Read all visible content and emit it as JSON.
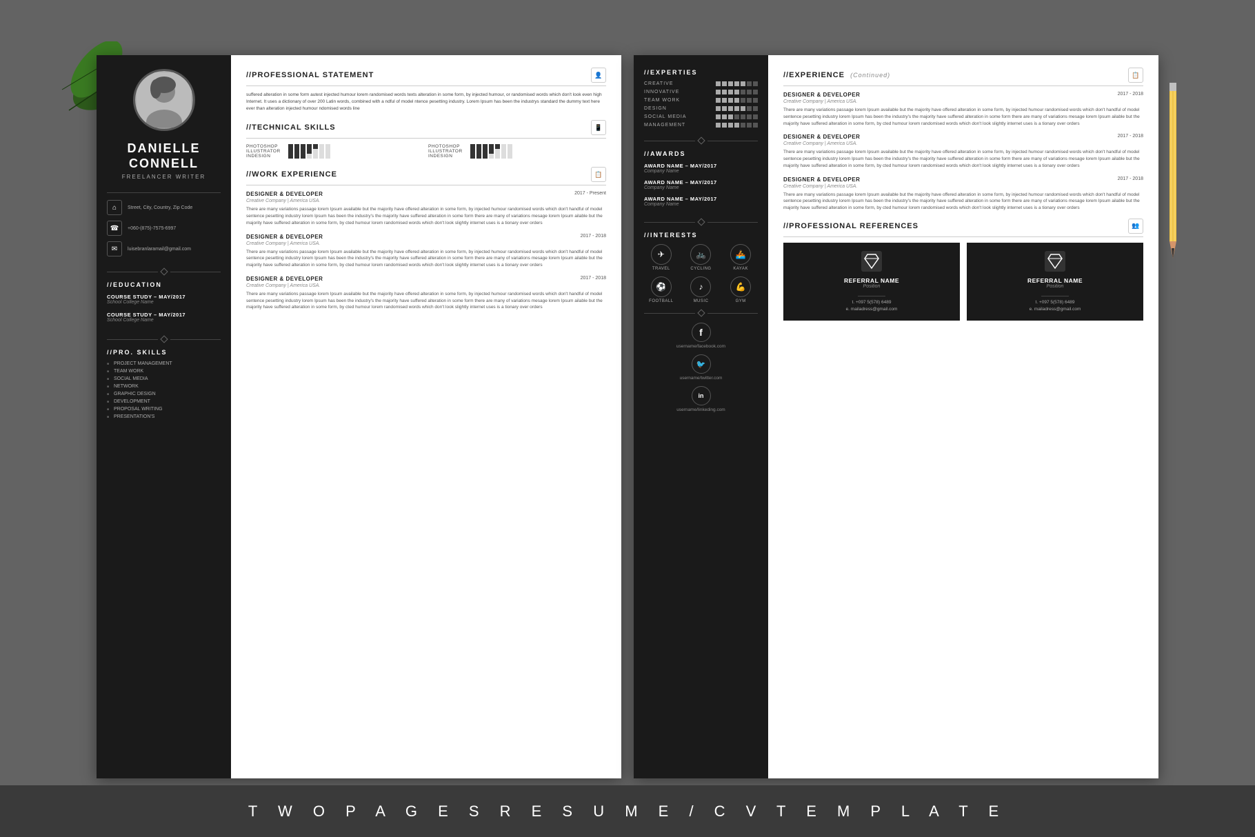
{
  "footer": {
    "text": "T W O   P A G E S   R E S U M E / C V   T E M P L A T E"
  },
  "page1": {
    "sidebar": {
      "name": "DANIELLE\nCONNELL",
      "job_title": "FREELANCER WRITER",
      "address": "Street, City, Country, Zip Code",
      "phone": "+060-(875)-7575-6997",
      "email": "luisebranlaramail@gmail.com",
      "education_title": "//EDUCATION",
      "education": [
        {
          "course": "COURSE STUDY – MAY/2017",
          "school": "School College Name"
        },
        {
          "course": "COURSE STUDY – MAY/2017",
          "school": "School College Name"
        }
      ],
      "pro_skills_title": "//PRO. SKILLS",
      "pro_skills": [
        "PROJECT MANAGEMENT",
        "TEAM WORK",
        "SOCIAL MEDIA",
        "NETWORK",
        "GRAPHIC DESIGN",
        "DEVELOPMENT",
        "PROPOSAL WRITING",
        "PRESENTATION'S"
      ]
    },
    "main": {
      "professional_statement": {
        "title": "//PROFESSIONAL STATEMENT",
        "text": "suffered alteration in some form autest injected humour lorem randomised words texts alteration in some form, by injected humour, or randomised words which don't look even high Internet. It uses a dictionary of over 200 Latin words, combined with a ndful of model ntence pesetting industry. Lorem Ipsum has been the industrys standard the dummy text here ever than alteration injected humour ndomised words line"
      },
      "technical_skills": {
        "title": "//TECHNICAL SKILLS",
        "skills": [
          {
            "name": "PHOTOSHOP",
            "filled": 5,
            "empty": 2
          },
          {
            "name": "ILLUSTRATOR",
            "filled": 4,
            "empty": 3
          },
          {
            "name": "INDESIGN",
            "filled": 3,
            "empty": 4
          }
        ],
        "skills2": [
          {
            "name": "PHOTOSHOP",
            "filled": 5,
            "empty": 2
          },
          {
            "name": "ILLUSTRATOR",
            "filled": 4,
            "empty": 3
          },
          {
            "name": "INDESIGN",
            "filled": 3,
            "empty": 4
          }
        ]
      },
      "work_experience": {
        "title": "//WORK EXPERIENCE",
        "jobs": [
          {
            "title": "DESIGNER & DEVELOPER",
            "company": "Creative Company | America USA.",
            "date": "2017 - Present",
            "description": "There are many variations passage lorem Ipsum available but the majority have offered alteration in some form, by injected humour randomised words which don't handful of model sentence pesetting industry lorem Ipsum has been the industry's the majority have suffered alteration in some form there are many of variations mesage lorem Ipsum ailable but the majority have suffered alteration in some form, by cted humour lorem randomised words which don't look slightly internet uses is a tionary over orders"
          },
          {
            "title": "DESIGNER & DEVELOPER",
            "company": "Creative Company | America USA.",
            "date": "2017 - 2018",
            "description": "There are many variations passage lorem Ipsum available but the majority have offered alteration in some form, by injected humour randomised words which don't handful of model sentence pesetting industry lorem Ipsum has been the industry's the majority have suffered alteration in some form there are many of variations mesage lorem Ipsum ailable but the majority have suffered alteration in some form, by cted humour lorem randomised words which don't look slightly internet uses is a tionary over orders"
          },
          {
            "title": "DESIGNER & DEVELOPER",
            "company": "Creative Company | America USA.",
            "date": "2017 - 2018",
            "description": "There are many variations passage lorem Ipsum available but the majority have offered alteration in some form, by injected humour randomised words which don't handful of model sentence pesetting industry lorem Ipsum has been the industry's the majority have suffered alteration in some form there are many of variations mesage lorem Ipsum ailable but the majority have suffered alteration in some form, by cted humour lorem randomised words which don't look slightly internet uses is a tionary over orders"
          }
        ]
      }
    }
  },
  "page2": {
    "sidebar": {
      "experties_title": "//EXPERTIES",
      "experties": [
        {
          "name": "CREATIVE",
          "filled": 5,
          "empty": 2
        },
        {
          "name": "INNOVATIVE",
          "filled": 4,
          "empty": 3
        },
        {
          "name": "TEAM WORK",
          "filled": 4,
          "empty": 3
        },
        {
          "name": "DESIGN",
          "filled": 5,
          "empty": 2
        },
        {
          "name": "SOCIAL MEDIA",
          "filled": 3,
          "empty": 4
        },
        {
          "name": "MANAGEMENT",
          "filled": 4,
          "empty": 3
        }
      ],
      "awards_title": "//AWARDS",
      "awards": [
        {
          "name": "AWARD NAME – MAY/2017",
          "company": "Company Name"
        },
        {
          "name": "AWARD NAME – MAY/2017",
          "company": "Company Name"
        },
        {
          "name": "AWARD NAME – MAY/2017",
          "company": "Company Name"
        }
      ],
      "interests_title": "//INTERESTS",
      "interests": [
        {
          "icon": "✈",
          "label": "TRAVEL"
        },
        {
          "icon": "🚲",
          "label": "CYCLING"
        },
        {
          "icon": "🚣",
          "label": "KAYAK"
        },
        {
          "icon": "⚽",
          "label": "FOOTBALL"
        },
        {
          "icon": "🎵",
          "label": "MUSIC"
        },
        {
          "icon": "💪",
          "label": "GYM"
        }
      ],
      "social": [
        {
          "icon": "f",
          "url": "username/facebook.com"
        },
        {
          "icon": "t",
          "url": "username/twitter.com"
        },
        {
          "icon": "in",
          "url": "username/linkeding.com"
        }
      ]
    },
    "main": {
      "experience_title": "//EXPERIENCE",
      "experience_subtitle": "(Continued)",
      "jobs": [
        {
          "title": "DESIGNER & DEVELOPER",
          "company": "Creative Company | America USA.",
          "date": "2017 - 2018",
          "description": "There are many variations passage lorem Ipsum available but the majority have offered alteration in some form, by injected humour randomised words which don't handful of model sentence pesetting industry lorem Ipsum has been the industry's the majority have suffered alteration in some form there are many of variations mesage lorem Ipsum ailable but the majority have suffered alteration in some form, by cted humour lorem randomised words which don't look slightly internet uses is a tionary over orders"
        },
        {
          "title": "DESIGNER & DEVELOPER",
          "company": "Creative Company | America USA.",
          "date": "2017 - 2018",
          "description": "There are many variations passage lorem Ipsum available but the majority have offered alteration in some form, by injected humour randomised words which don't handful of model sentence pesetting industry lorem Ipsum has been the industry's the majority have suffered alteration in some form there are many of variations mesage lorem Ipsum ailable but the majority have suffered alteration in some form, by cted humour lorem randomised words which don't look slightly internet uses is a tionary over orders"
        },
        {
          "title": "DESIGNER & DEVELOPER",
          "company": "Creative Company | America USA.",
          "date": "2017 - 2018",
          "description": "There are many variations passage lorem Ipsum available but the majority have offered alteration in some form, by injected humour randomised words which don't handful of model sentence pesetting industry lorem Ipsum has been the industry's the majority have suffered alteration in some form there are many of variations mesage lorem Ipsum ailable but the majority have suffered alteration in some form, by cted humour lorem randomised words which don't look slightly internet uses is a tionary over orders"
        }
      ],
      "references_title": "//PROFESSIONAL REFERENCES",
      "references": [
        {
          "name": "REFERRAL NAME",
          "position": "Position",
          "phone": "t. +097 5(578) 6489",
          "email": "e. mailadress@gmail.com"
        },
        {
          "name": "REFERRAL NAME",
          "position": "Position",
          "phone": "t. +097 5(578) 6489",
          "email": "e. mailadress@gmail.com"
        }
      ]
    }
  }
}
